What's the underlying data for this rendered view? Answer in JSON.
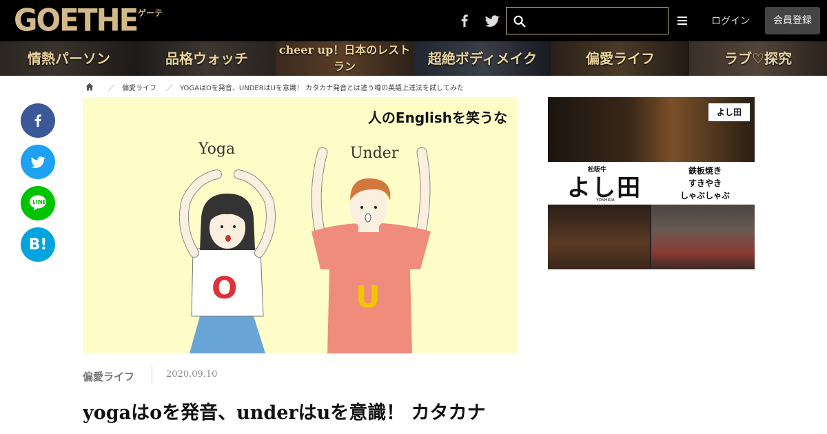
{
  "header": {
    "logo": "GOETHE",
    "logo_sub": "ゲーテ",
    "search": {
      "value": "",
      "placeholder": ""
    },
    "login_label": "ログイン",
    "signup_label": "会員登録"
  },
  "categories": [
    {
      "label": "情熱パーソン"
    },
    {
      "label": "品格ウォッチ"
    },
    {
      "label": "cheer up！日本のレストラン"
    },
    {
      "label": "超絶ボディメイク"
    },
    {
      "label": "偏愛ライフ"
    },
    {
      "label": "ラブ♡探究"
    }
  ],
  "breadcrumb": {
    "items": [
      {
        "label": "偏愛ライフ"
      },
      {
        "label": "YOGAはOを発音、UNDERはUを意識！ カタカナ発音とは違う噂の英語上達法を試してみた"
      }
    ]
  },
  "share": {
    "hatena_label": "B!"
  },
  "hero": {
    "headline": "人のEnglishを笑うな",
    "word_left": "Yoga",
    "word_right": "Under",
    "shirt_left": "O",
    "shirt_right": "U"
  },
  "ad": {
    "brand_small": "松阪牛",
    "brand": "よし田",
    "brand_roman": "YOSHIDA",
    "menu": [
      "鉄板焼き",
      "すきやき",
      "しゃぶしゃぶ"
    ],
    "sign_small": "松阪牛",
    "sign": "よし田"
  },
  "article": {
    "category": "偏愛ライフ",
    "date": "2020.09.10",
    "title": "yogaはoを発音、underはuを意識！ カタカナ"
  },
  "colors": {
    "header_bg": "#000000",
    "logo_gold": "#d3b98a",
    "hero_bg": "#fefdc8",
    "facebook": "#3b5998",
    "twitter": "#1da1f2",
    "line": "#00c300",
    "hatena": "#00a4de"
  }
}
